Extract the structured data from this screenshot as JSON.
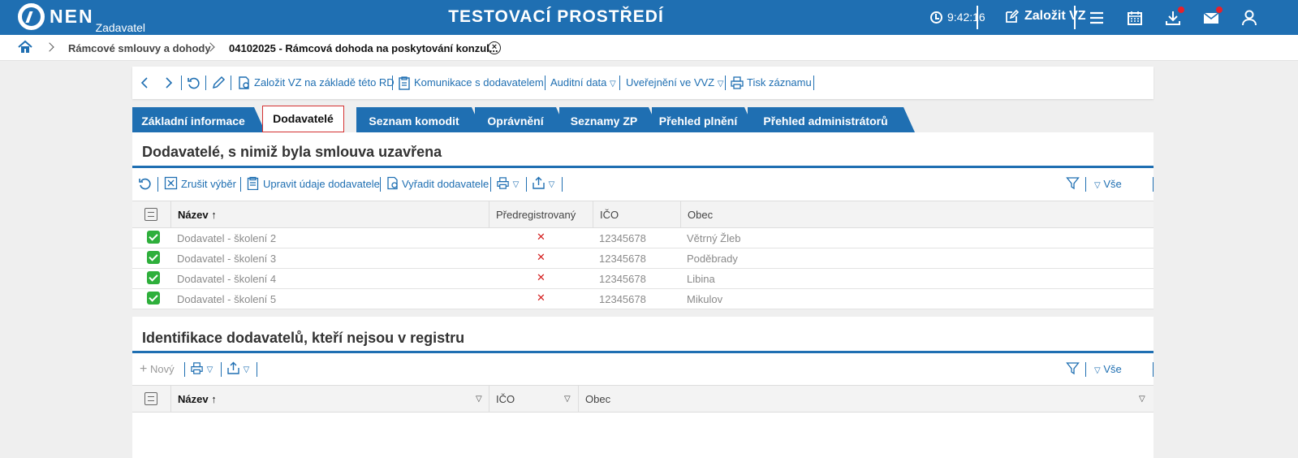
{
  "header": {
    "logo": "NEN",
    "logo_sub": "Zadavatel",
    "env_title": "TESTOVACÍ PROSTŘEDÍ",
    "time": "9:42:16",
    "create_label": "Založit VZ",
    "icons": [
      "menu-icon",
      "calendar-icon",
      "download-icon",
      "mail-icon",
      "user-icon"
    ]
  },
  "breadcrumb": {
    "items": [
      "Rámcové smlouvy a dohody",
      "04102025 - Rámcová dohoda na poskytování konzul..."
    ]
  },
  "actions": {
    "create_from_rd": "Založit VZ na základě této RD",
    "communication": "Komunikace s dodavatelem",
    "audit": "Auditní data",
    "publish": "Uveřejnění ve VVZ",
    "print": "Tisk záznamu"
  },
  "tabs": [
    "Základní informace",
    "Dodavatelé",
    "Seznam komodit",
    "Oprávnění",
    "Seznamy ZP",
    "Přehled plnění",
    "Přehled administrátorů"
  ],
  "section1": {
    "title": "Dodavatelé, s nimiž byla smlouva uzavřena",
    "toolbar": {
      "clear": "Zrušit výběr",
      "edit": "Upravit údaje dodavatele",
      "remove": "Vyřadit dodavatele",
      "all": "Vše"
    },
    "columns": [
      "Název",
      "Předregistrovaný",
      "IČO",
      "Obec"
    ],
    "rows": [
      {
        "name": "Dodavatel - školení 2",
        "ico": "12345678",
        "city": "Větrný Žleb"
      },
      {
        "name": "Dodavatel - školení 3",
        "ico": "12345678",
        "city": "Poděbrady"
      },
      {
        "name": "Dodavatel - školení 4",
        "ico": "12345678",
        "city": "Libina"
      },
      {
        "name": "Dodavatel - školení 5",
        "ico": "12345678",
        "city": "Mikulov"
      }
    ]
  },
  "section2": {
    "title": "Identifikace dodavatelů, kteří nejsou v registru",
    "toolbar": {
      "new": "Nový",
      "all": "Vše"
    },
    "columns": [
      "Název",
      "IČO",
      "Obec"
    ]
  },
  "colors": {
    "primary": "#1f6fb2",
    "check": "#2eaf3b",
    "cross": "#d42020",
    "active_tab_border": "#d43030"
  }
}
